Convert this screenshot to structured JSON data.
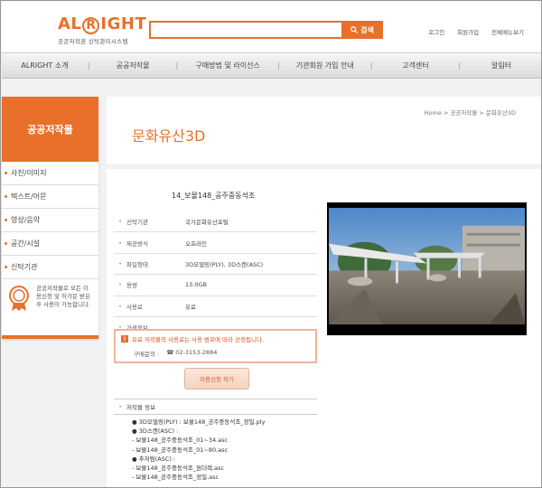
{
  "header": {
    "logo_prefix": "AL",
    "logo_r": "R",
    "logo_suffix": "IGHT",
    "logo_sub": "공공저작권 신탁관리시스템",
    "search_label": "검색",
    "util": [
      "로그인",
      "회원가입",
      "전체메뉴보기"
    ]
  },
  "nav": [
    "ALRIGHT 소개",
    "공공저작물",
    "구매방법 및 라이선스",
    "기관회원 가입 안내",
    "고객센터",
    "알림터"
  ],
  "sidebar": {
    "title": "공공저작물",
    "items": [
      "사진/이미지",
      "텍스트/어문",
      "영상/음악",
      "공간/시설",
      "신탁기관"
    ],
    "notice": "공공저작물로 모든 이용신청 및 허가문 받은 후 사용이 가능합니다."
  },
  "page": {
    "title": "문화유산3D",
    "breadcrumb": "Home > 공공저작물 > 문화유산3D"
  },
  "item": {
    "title": "14_보물148_공주중동석조",
    "rows": [
      {
        "label": "신탁기관",
        "value": "국가문화유산포털"
      },
      {
        "label": "제공방식",
        "value": "오프라인"
      },
      {
        "label": "파일형태",
        "value": "3D모델링(PLY), 3D스캔(ASC)"
      },
      {
        "label": "용량",
        "value": "13.0GB"
      },
      {
        "label": "사용료",
        "value": "유료"
      },
      {
        "label": "가격정보",
        "value": ""
      }
    ],
    "notice": "유료 저작물의 사용료는 사용 범위에 따라 산정됩니다.",
    "contact_label": "구매문의 :",
    "contact_phone": "02-3153-2884",
    "apply_label": "이용신청 하기",
    "list_header": "저작물 정보",
    "list": [
      "● 3D모델링(PLY) : 보물148_공주중동석조_정밀.ply",
      "● 3D스캔(ASC) :",
      "- 보물148_공주중동석조_01~34.asc",
      "- 보물148_공주중동석조_01~80.asc",
      "● 추처럼(ASC) :",
      "- 보물148_공주중동석조_원더렉.asc",
      "- 보물148_공주중동석조_정밀.asc"
    ]
  },
  "colors": {
    "accent": "#e8702a",
    "notice_border": "#f0b49a"
  }
}
